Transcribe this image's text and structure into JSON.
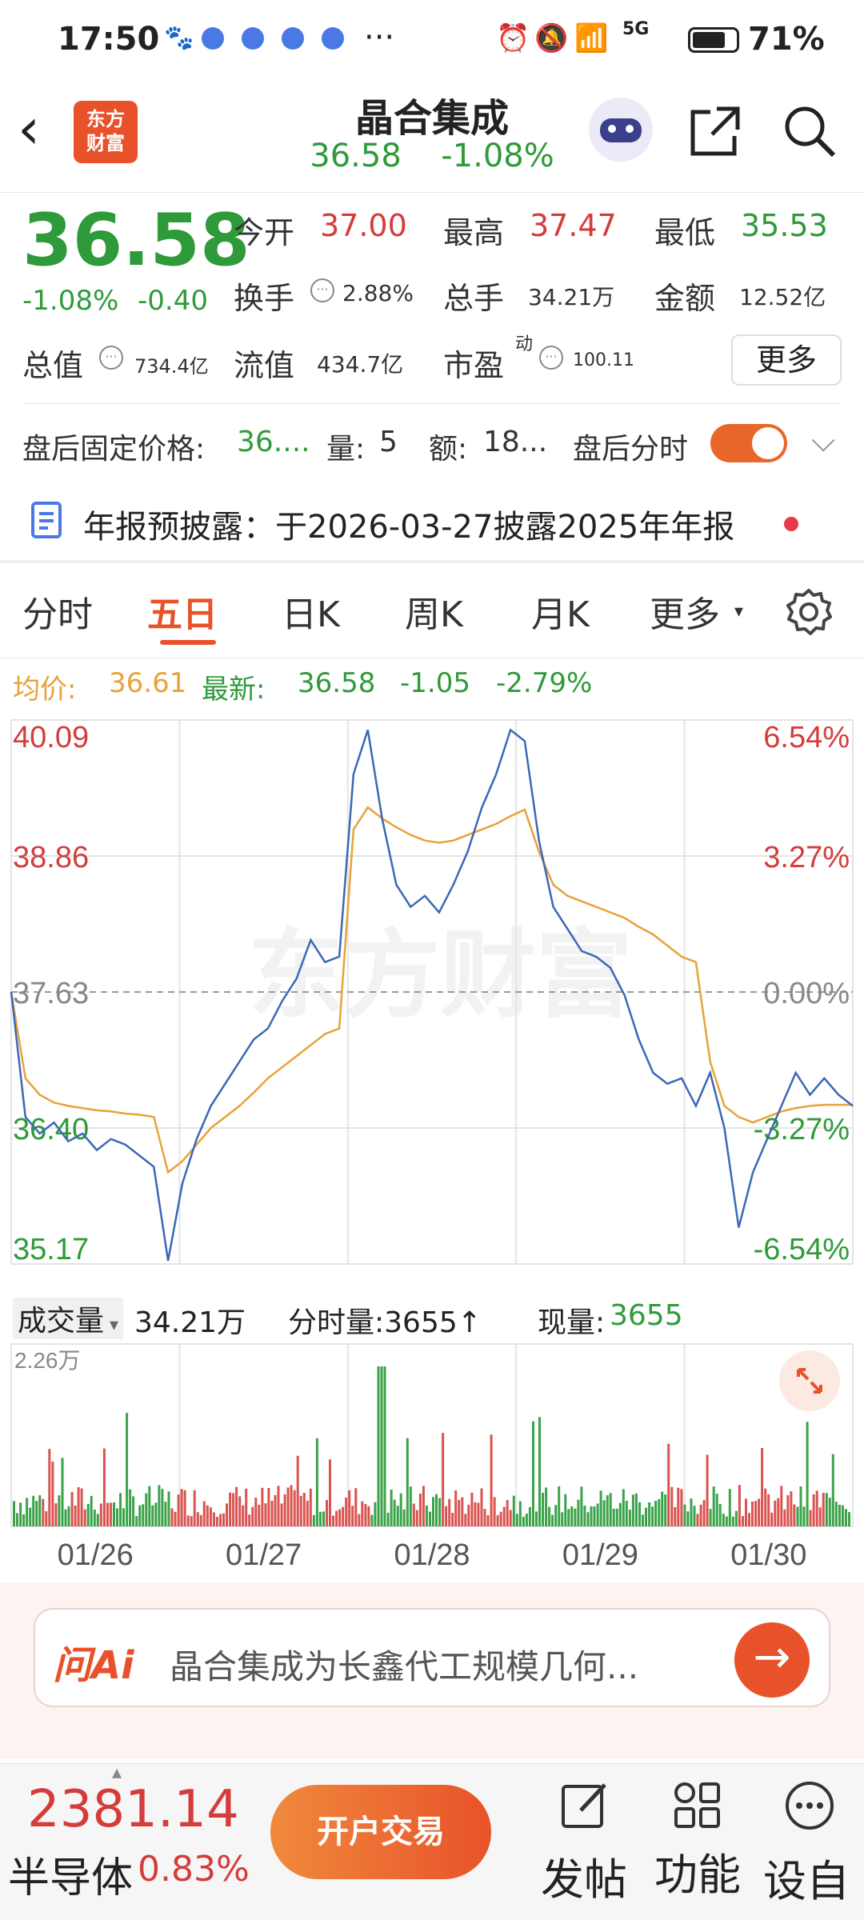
{
  "status_bar": {
    "time": "17:50",
    "battery": "71%",
    "network": "5G",
    "dots": "···"
  },
  "header": {
    "logo_text": "东方\n财富",
    "stock_name": "晶合集成",
    "price": "36.58",
    "change_pct": "-1.08%"
  },
  "quote": {
    "price": "36.58",
    "change_pct": "-1.08%",
    "change_abs": "-0.40",
    "open_label": "今开",
    "open": "37.00",
    "high_label": "最高",
    "high": "37.47",
    "low_label": "最低",
    "low": "35.53",
    "turnover_label": "换手",
    "turnover": "2.88%",
    "volume_label": "总手",
    "volume": "34.21万",
    "amount_label": "金额",
    "amount": "12.52亿",
    "mktcap_label": "总值",
    "mktcap": "734.4亿",
    "float_label": "流值",
    "float": "434.7亿",
    "pe_label": "市盈",
    "pe_sup": "动",
    "pe": "100.11",
    "more_label": "更多"
  },
  "after_hours": {
    "price_label": "盘后固定价格:",
    "price": "36....",
    "vol_label": "量:",
    "vol": "5",
    "amt_label": "额:",
    "amt": "18...",
    "time_label": "盘后分时"
  },
  "notice": {
    "text": "年报预披露：于2026-03-27披露2025年年报"
  },
  "tabs": [
    "分时",
    "五日",
    "日K",
    "周K",
    "月K",
    "更多"
  ],
  "active_tab": 1,
  "chart_info": {
    "avg_label": "均价:",
    "avg": "36.61",
    "latest_label": "最新:",
    "latest": "36.58",
    "chg": "-1.05",
    "chg_pct": "-2.79%"
  },
  "watermark": "东方财富",
  "volume_info": {
    "label": "成交量",
    "total": "34.21万",
    "tick_label": "分时量:3655↑",
    "cur_label": "现量:",
    "cur": "3655",
    "ymax": "2.26万"
  },
  "chart_data": {
    "type": "line",
    "y_price_labels": [
      "40.09",
      "38.86",
      "37.63",
      "36.40",
      "35.17"
    ],
    "y_pct_labels": [
      "6.54%",
      "3.27%",
      "0.00%",
      "-3.27%",
      "-6.54%"
    ],
    "ylim": [
      35.17,
      40.09
    ],
    "prev_close": 37.63,
    "x_labels": [
      "01/26",
      "01/27",
      "01/28",
      "01/29",
      "01/30"
    ],
    "series": [
      {
        "name": "price",
        "color": "#3b68b5",
        "values": [
          37.63,
          36.5,
          36.35,
          36.45,
          36.28,
          36.35,
          36.2,
          36.3,
          36.25,
          36.15,
          36.05,
          35.2,
          35.9,
          36.3,
          36.6,
          36.8,
          37.0,
          37.2,
          37.3,
          37.55,
          37.75,
          38.1,
          37.9,
          37.95,
          39.6,
          40.0,
          39.2,
          38.6,
          38.4,
          38.5,
          38.35,
          38.6,
          38.9,
          39.3,
          39.6,
          40.0,
          39.9,
          39.0,
          38.4,
          38.2,
          38.0,
          37.95,
          37.85,
          37.6,
          37.2,
          36.9,
          36.8,
          36.85,
          36.6,
          36.9,
          36.4,
          35.5,
          36.0,
          36.3,
          36.6,
          36.9,
          36.7,
          36.85,
          36.7,
          36.6
        ]
      },
      {
        "name": "avg",
        "color": "#e8a23a",
        "values": [
          37.63,
          36.85,
          36.7,
          36.63,
          36.6,
          36.58,
          36.56,
          36.55,
          36.53,
          36.52,
          36.5,
          36.0,
          36.1,
          36.25,
          36.4,
          36.5,
          36.6,
          36.72,
          36.85,
          36.95,
          37.05,
          37.15,
          37.25,
          37.3,
          39.1,
          39.3,
          39.2,
          39.12,
          39.05,
          39.0,
          38.98,
          39.0,
          39.05,
          39.1,
          39.15,
          39.22,
          39.28,
          38.9,
          38.6,
          38.5,
          38.45,
          38.4,
          38.35,
          38.3,
          38.22,
          38.15,
          38.05,
          37.95,
          37.9,
          37.0,
          36.6,
          36.5,
          36.45,
          36.5,
          36.55,
          36.58,
          36.6,
          36.61,
          36.61,
          36.61
        ]
      }
    ]
  },
  "ai_bar": {
    "logo": "问Ai",
    "text": "晶合集成为长鑫代工规模几何..."
  },
  "bottom": {
    "index_value": "2381.14",
    "index_name": "半导体",
    "index_pct": "0.83%",
    "trade_label": "开户交易",
    "post_label": "发帖",
    "func_label": "功能",
    "custom_label": "设自"
  }
}
